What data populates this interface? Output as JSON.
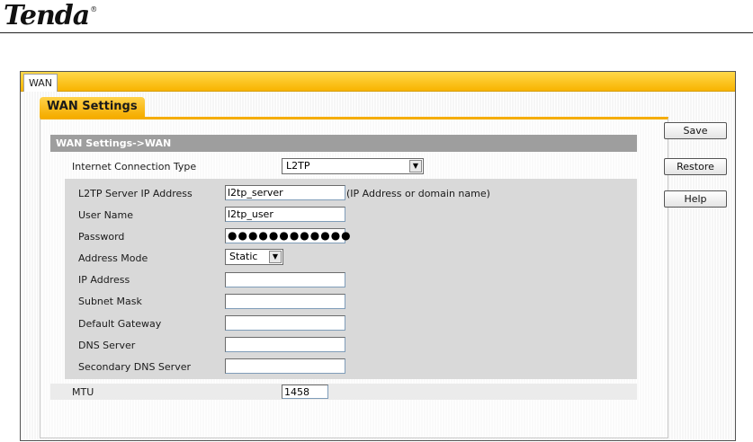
{
  "brand": {
    "logo": "Tenda",
    "reg": "®"
  },
  "tabs": [
    {
      "label": "WAN"
    }
  ],
  "subtab": {
    "label": "WAN Settings"
  },
  "section": {
    "title": "WAN Settings->WAN"
  },
  "connection": {
    "label": "Internet Connection Type",
    "value": "L2TP"
  },
  "fields": {
    "server": {
      "label": "L2TP Server IP Address",
      "value": "l2tp_server",
      "hint": "(IP Address or domain name)"
    },
    "username": {
      "label": "User Name",
      "value": "l2tp_user"
    },
    "password": {
      "label": "Password",
      "masked": "●●●●●●●●●●●●"
    },
    "address_mode": {
      "label": "Address Mode",
      "value": "Static"
    },
    "ip": {
      "label": "IP Address",
      "value": ""
    },
    "subnet": {
      "label": "Subnet Mask",
      "value": ""
    },
    "gateway": {
      "label": "Default Gateway",
      "value": ""
    },
    "dns": {
      "label": "DNS Server",
      "value": ""
    },
    "dns2": {
      "label": "Secondary DNS Server",
      "value": ""
    },
    "mtu": {
      "label": "MTU",
      "value": "1458"
    }
  },
  "buttons": {
    "save": "Save",
    "restore": "Restore",
    "help": "Help"
  },
  "icons": {
    "dropdown": "triangle-down-icon"
  },
  "colors": {
    "accent": "#f8b400",
    "header": "#9e9e9e",
    "panel": "#d9d9d9"
  }
}
